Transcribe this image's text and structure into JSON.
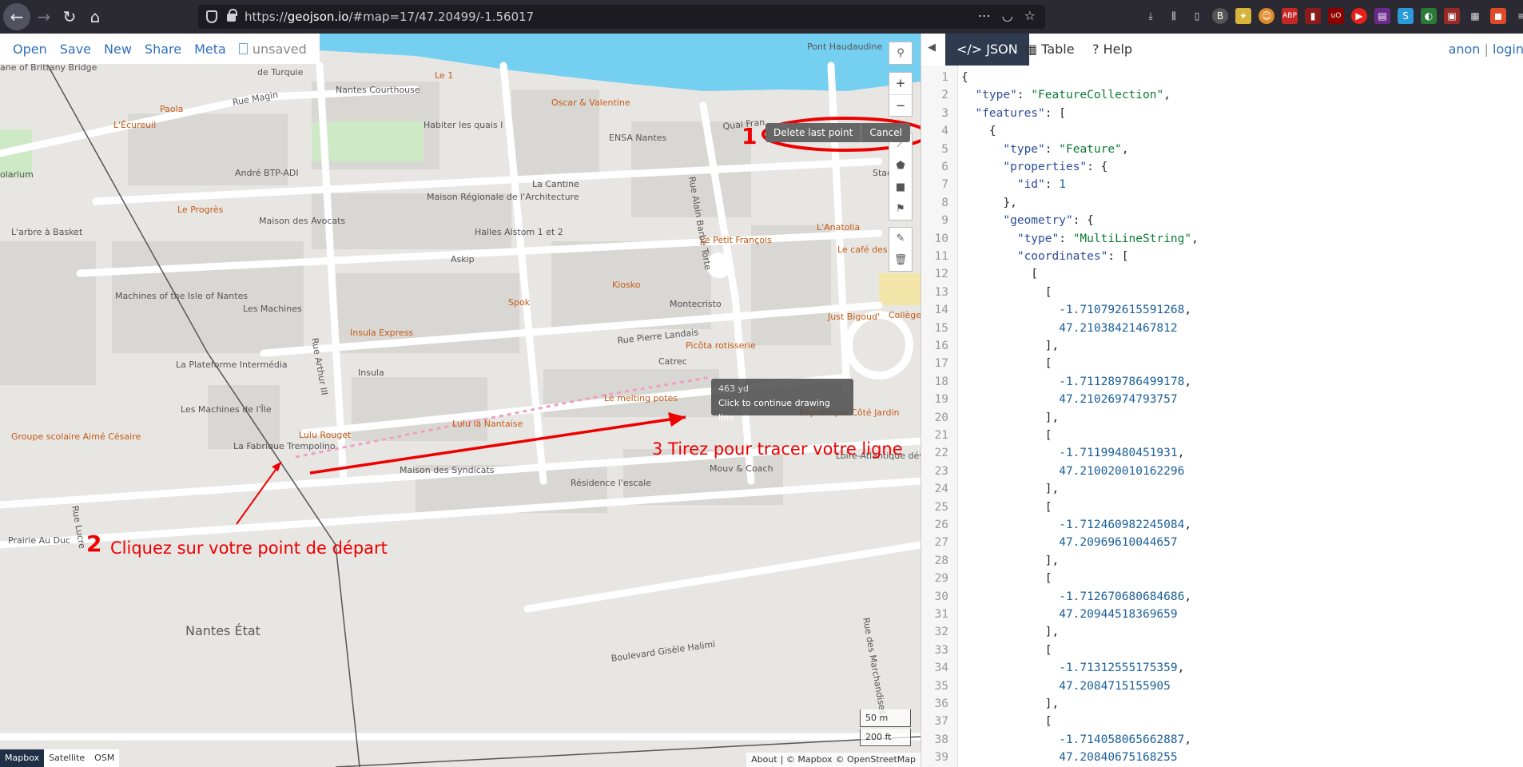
{
  "browser": {
    "url_prefix": "https://",
    "url_domain": "geojson.io",
    "url_path": "/#map=17/47.20499/-1.56017"
  },
  "app": {
    "menu": [
      "Open",
      "Save",
      "New",
      "Share",
      "Meta"
    ],
    "unsaved_label": "unsaved",
    "draw_popup": {
      "delete_label": "Delete last point",
      "cancel_label": "Cancel"
    },
    "tooltip": {
      "distance": "463 yd",
      "hint": "Click to continue drawing line"
    },
    "layers": [
      "Mapbox",
      "Satellite",
      "OSM"
    ],
    "active_layer": "Mapbox",
    "scale": {
      "metric": "50 m",
      "imperial": "200 ft"
    },
    "attribution": {
      "about": "About",
      "mapbox": "| © Mapbox",
      "osm": "© OpenStreetMap"
    }
  },
  "annotations": {
    "step1_num": "1",
    "step2_num": "2",
    "step2_text": "Cliquez sur votre point de départ",
    "step3_text": "3 Tirez pour tracer votre ligne"
  },
  "map_labels": [
    {
      "text": "Pont Haudaudine",
      "poi": false
    },
    {
      "text": "Nantes Courthouse",
      "poi": false
    },
    {
      "text": "Rue Magin",
      "poi": false
    },
    {
      "text": "Le 1",
      "poi": true
    },
    {
      "text": "de Turquie",
      "poi": false
    },
    {
      "text": "Paola",
      "poi": true
    },
    {
      "text": "L'Écureuil",
      "poi": true
    },
    {
      "text": "Habiter les quais I",
      "poi": false
    },
    {
      "text": "Oscar & Valentine",
      "poi": true
    },
    {
      "text": "ENSA Nantes",
      "poi": false
    },
    {
      "text": "Quai Fran",
      "poi": false
    },
    {
      "text": "André BTP-ADI",
      "poi": false
    },
    {
      "text": "La Cantine",
      "poi": false
    },
    {
      "text": "Rue Alain Barbe Torte",
      "poi": false
    },
    {
      "text": "Stadiu",
      "poi": false
    },
    {
      "text": "Maison Régionale de l'Architecture",
      "poi": false
    },
    {
      "text": "Le Progrès",
      "poi": true
    },
    {
      "text": "Maison des Avocats",
      "poi": false
    },
    {
      "text": "Halles Alstom 1 et 2",
      "poi": false
    },
    {
      "text": "Le Petit François",
      "poi": true
    },
    {
      "text": "L'Anatolia",
      "poi": true
    },
    {
      "text": "L'arbre à Basket",
      "poi": false
    },
    {
      "text": "Askip",
      "poi": false
    },
    {
      "text": "Le café des p",
      "poi": true
    },
    {
      "text": "Kiosko",
      "poi": true
    },
    {
      "text": "Machines of the Isle of Nantes",
      "poi": false
    },
    {
      "text": "Les Machines",
      "poi": false
    },
    {
      "text": "Spok",
      "poi": true
    },
    {
      "text": "Montecristo",
      "poi": false
    },
    {
      "text": "Just Bigoud'",
      "poi": true
    },
    {
      "text": "Collège Aristide",
      "poi": true
    },
    {
      "text": "Rue Arthur III",
      "poi": false
    },
    {
      "text": "Insula Express",
      "poi": true
    },
    {
      "text": "Rue Pierre Landais",
      "poi": false
    },
    {
      "text": "Picôta rotisserie",
      "poi": true
    },
    {
      "text": "La Plateforme Intermédia",
      "poi": false
    },
    {
      "text": "Insula",
      "poi": false
    },
    {
      "text": "Catrec",
      "poi": false
    },
    {
      "text": "Le melting potes",
      "poi": true
    },
    {
      "text": "Les Machines de l'Île",
      "poi": false
    },
    {
      "text": "République Côté Jardin",
      "poi": true
    },
    {
      "text": "Groupe scolaire Aimé Césaire",
      "poi": true
    },
    {
      "text": "Lulu la Nantaise",
      "poi": true
    },
    {
      "text": "Lulu Rouget",
      "poi": true
    },
    {
      "text": "La Fabrique Trempolino",
      "poi": false
    },
    {
      "text": "Loire-Atlantique développement",
      "poi": false
    },
    {
      "text": "Maison des Syndicats",
      "poi": false
    },
    {
      "text": "Mouv & Coach",
      "poi": false
    },
    {
      "text": "Résidence l'escale",
      "poi": false
    },
    {
      "text": "Rue Lucre",
      "poi": false
    },
    {
      "text": "Prairie Au Duc",
      "poi": false
    },
    {
      "text": "Nantes État",
      "poi": false
    },
    {
      "text": "Boulevard Gisèle Halimi",
      "poi": false
    },
    {
      "text": "Rue des Marchandises",
      "poi": false
    },
    {
      "text": "olarium",
      "poi": false
    },
    {
      "text": "ane of Brittany Bridge",
      "poi": false
    }
  ],
  "panel": {
    "tabs": [
      "JSON",
      "Table",
      "Help"
    ],
    "user": "anon",
    "login": "login",
    "code_lines": [
      "{",
      "  \"type\": \"FeatureCollection\",",
      "  \"features\": [",
      "    {",
      "      \"type\": \"Feature\",",
      "      \"properties\": {",
      "        \"id\": 1",
      "      },",
      "      \"geometry\": {",
      "        \"type\": \"MultiLineString\",",
      "        \"coordinates\": [",
      "          [",
      "            [",
      "              -1.710792615591268,",
      "              47.21038421467812",
      "            ],",
      "            [",
      "              -1.711289786499178,",
      "              47.21026974793757",
      "            ],",
      "            [",
      "              -1.71199480451931,",
      "              47.210020010162296",
      "            ],",
      "            [",
      "              -1.712460982245084,",
      "              47.20969610044657",
      "            ],",
      "            [",
      "              -1.712670680684686,",
      "              47.20944518369659",
      "            ],",
      "            [",
      "              -1.71312555175359,",
      "              47.2084715155905",
      "            ],",
      "            [",
      "              -1.714058065662887,",
      "              47.20840675168255"
    ]
  }
}
